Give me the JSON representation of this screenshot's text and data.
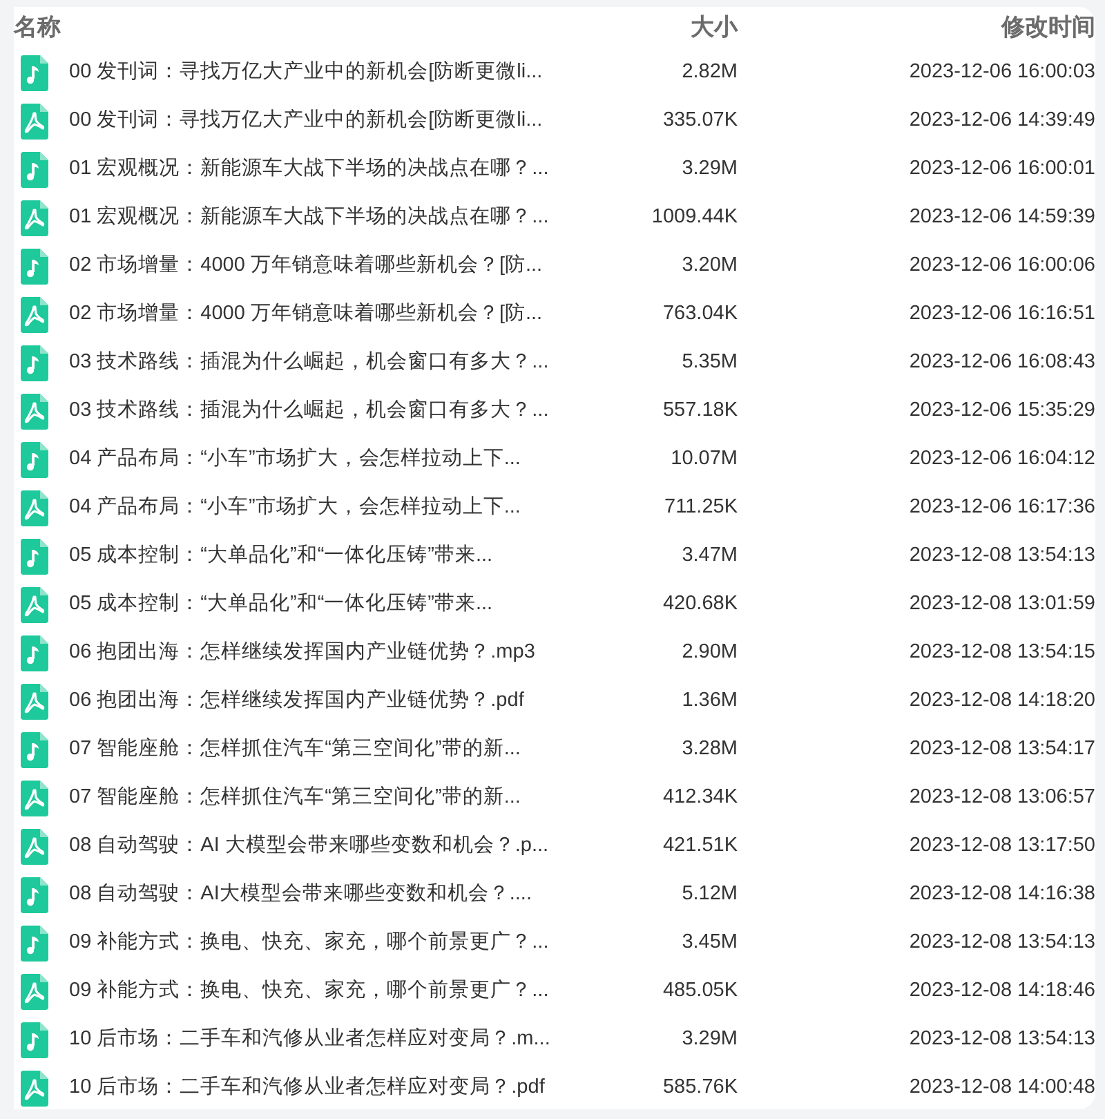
{
  "table": {
    "columns": [
      "名称",
      "大小",
      "修改时间"
    ],
    "rows": [
      {
        "kind": "audio",
        "name": "00 发刊词：寻找万亿大产业中的新机会[防断更微li...",
        "size": "2.82M",
        "modified": "2023-12-06 16:00:03"
      },
      {
        "kind": "pdf",
        "name": "00 发刊词：寻找万亿大产业中的新机会[防断更微li...",
        "size": "335.07K",
        "modified": "2023-12-06 14:39:49"
      },
      {
        "kind": "audio",
        "name": "01 宏观概况：新能源车大战下半场的决战点在哪？...",
        "size": "3.29M",
        "modified": "2023-12-06 16:00:01"
      },
      {
        "kind": "pdf",
        "name": "01 宏观概况：新能源车大战下半场的决战点在哪？...",
        "size": "1009.44K",
        "modified": "2023-12-06 14:59:39"
      },
      {
        "kind": "audio",
        "name": "02 市场增量：4000 万年销意味着哪些新机会？[防...",
        "size": "3.20M",
        "modified": "2023-12-06 16:00:06"
      },
      {
        "kind": "pdf",
        "name": "02 市场增量：4000 万年销意味着哪些新机会？[防...",
        "size": "763.04K",
        "modified": "2023-12-06 16:16:51"
      },
      {
        "kind": "audio",
        "name": "03 技术路线：插混为什么崛起，机会窗口有多大？...",
        "size": "5.35M",
        "modified": "2023-12-06 16:08:43"
      },
      {
        "kind": "pdf",
        "name": "03 技术路线：插混为什么崛起，机会窗口有多大？...",
        "size": "557.18K",
        "modified": "2023-12-06 15:35:29"
      },
      {
        "kind": "audio",
        "name": "04 产品布局：“小车”市场扩大，会怎样拉动上下...",
        "size": "10.07M",
        "modified": "2023-12-06 16:04:12"
      },
      {
        "kind": "pdf",
        "name": "04 产品布局：“小车”市场扩大，会怎样拉动上下...",
        "size": "711.25K",
        "modified": "2023-12-06 16:17:36"
      },
      {
        "kind": "audio",
        "name": "05 成本控制：“大单品化”和“一体化压铸”带来...",
        "size": "3.47M",
        "modified": "2023-12-08 13:54:13"
      },
      {
        "kind": "pdf",
        "name": "05 成本控制：“大单品化”和“一体化压铸”带来...",
        "size": "420.68K",
        "modified": "2023-12-08 13:01:59"
      },
      {
        "kind": "audio",
        "name": "06 抱团出海：怎样继续发挥国内产业链优势？.mp3",
        "size": "2.90M",
        "modified": "2023-12-08 13:54:15"
      },
      {
        "kind": "pdf",
        "name": "06 抱团出海：怎样继续发挥国内产业链优势？.pdf",
        "size": "1.36M",
        "modified": "2023-12-08 14:18:20"
      },
      {
        "kind": "audio",
        "name": "07 智能座舱：怎样抓住汽车“第三空间化”带的新...",
        "size": "3.28M",
        "modified": "2023-12-08 13:54:17"
      },
      {
        "kind": "pdf",
        "name": "07 智能座舱：怎样抓住汽车“第三空间化”带的新...",
        "size": "412.34K",
        "modified": "2023-12-08 13:06:57"
      },
      {
        "kind": "pdf",
        "name": "08 自动驾驶：AI 大模型会带来哪些变数和机会？.p...",
        "size": "421.51K",
        "modified": "2023-12-08 13:17:50"
      },
      {
        "kind": "audio",
        "name": "08 自动驾驶：AI大模型会带来哪些变数和机会？....",
        "size": "5.12M",
        "modified": "2023-12-08 14:16:38"
      },
      {
        "kind": "audio",
        "name": "09 补能方式：换电、快充、家充，哪个前景更广？...",
        "size": "3.45M",
        "modified": "2023-12-08 13:54:13"
      },
      {
        "kind": "pdf",
        "name": "09 补能方式：换电、快充、家充，哪个前景更广？...",
        "size": "485.05K",
        "modified": "2023-12-08 14:18:46"
      },
      {
        "kind": "audio",
        "name": "10 后市场：二手车和汽修从业者怎样应对变局？.m...",
        "size": "3.29M",
        "modified": "2023-12-08 13:54:13"
      },
      {
        "kind": "pdf",
        "name": "10 后市场：二手车和汽修从业者怎样应对变局？.pdf",
        "size": "585.76K",
        "modified": "2023-12-08 14:00:48"
      }
    ]
  }
}
